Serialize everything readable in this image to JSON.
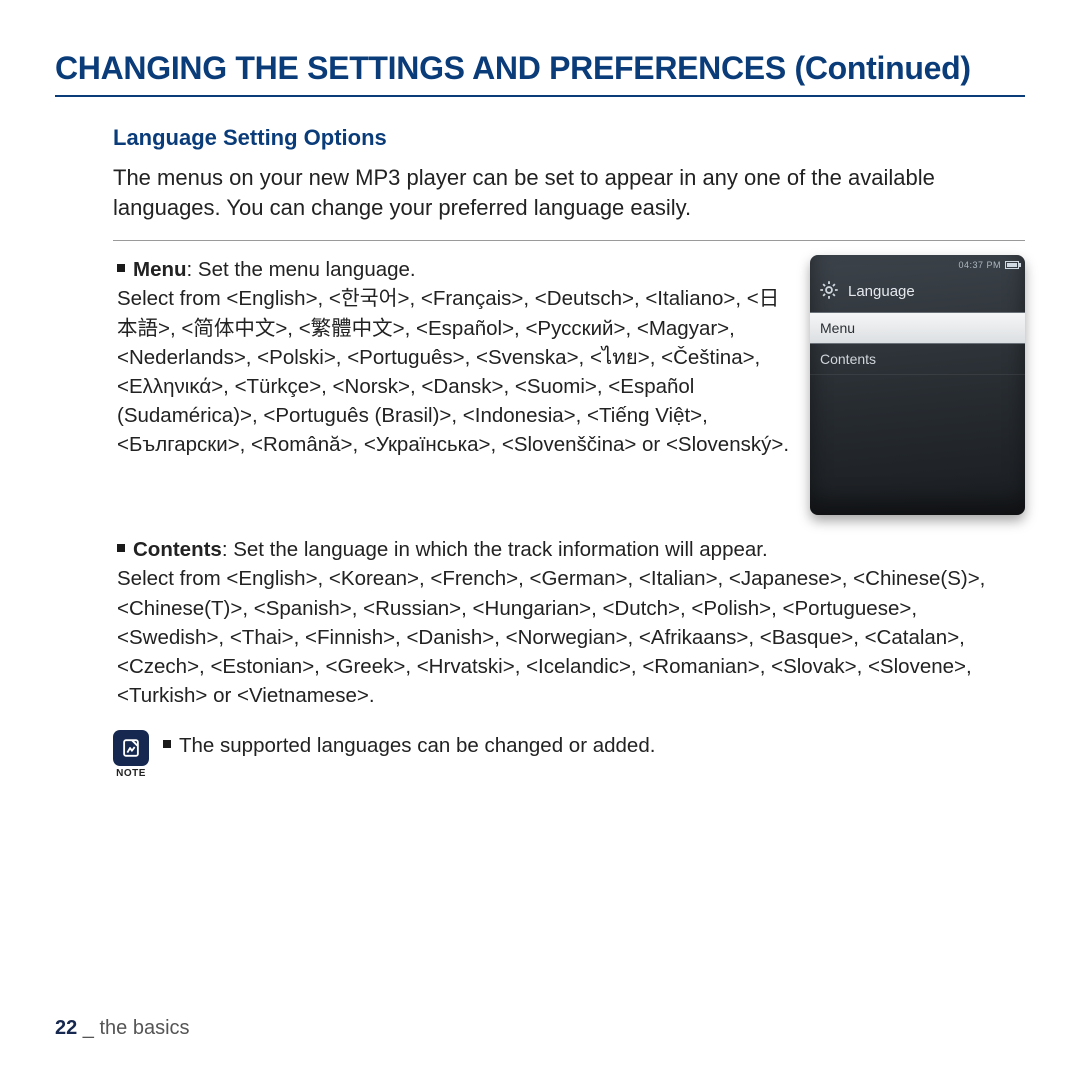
{
  "title": "CHANGING THE SETTINGS AND PREFERENCES (Continued)",
  "section_title": "Language Setting Options",
  "intro": "The menus on your new MP3 player can be set to appear in any one of the available languages. You can change your preferred language easily.",
  "bullets": {
    "menu": {
      "label": "Menu",
      "desc": ": Set the menu language.",
      "body": "Select from <English>, <한국어>, <Français>, <Deutsch>, <Italiano>, <日本語>, <简体中文>, <繁體中文>, <Español>, <Русский>, <Magyar>, <Nederlands>, <Polski>, <Português>, <Svenska>, <ไทย>, <Čeština>, <Ελληνικά>, <Türkçe>, <Norsk>, <Dansk>, <Suomi>, <Español (Sudamérica)>, <Português (Brasil)>, <Indonesia>, <Tiếng Việt>, <Български>, <Română>, <Українська>, <Slovenščina> or <Slovenský>."
    },
    "contents": {
      "label": "Contents",
      "desc": ": Set the language in which the track information will appear.",
      "body": "Select from <English>, <Korean>, <French>, <German>, <Italian>, <Japanese>, <Chinese(S)>, <Chinese(T)>, <Spanish>, <Russian>, <Hungarian>, <Dutch>, <Polish>, <Portuguese>, <Swedish>, <Thai>, <Finnish>, <Danish>, <Norwegian>, <Afrikaans>, <Basque>, <Catalan>, <Czech>, <Estonian>, <Greek>, <Hrvatski>, <Icelandic>, <Romanian>, <Slovak>, <Slovene>, <Turkish> or <Vietnamese>."
    }
  },
  "device": {
    "time": "04:37 PM",
    "header": "Language",
    "items": [
      "Menu",
      "Contents"
    ],
    "selected_index": 0
  },
  "note": {
    "caption": "NOTE",
    "text": "The supported languages can be changed or added."
  },
  "footer": {
    "page": "22",
    "section": " _ the basics"
  }
}
